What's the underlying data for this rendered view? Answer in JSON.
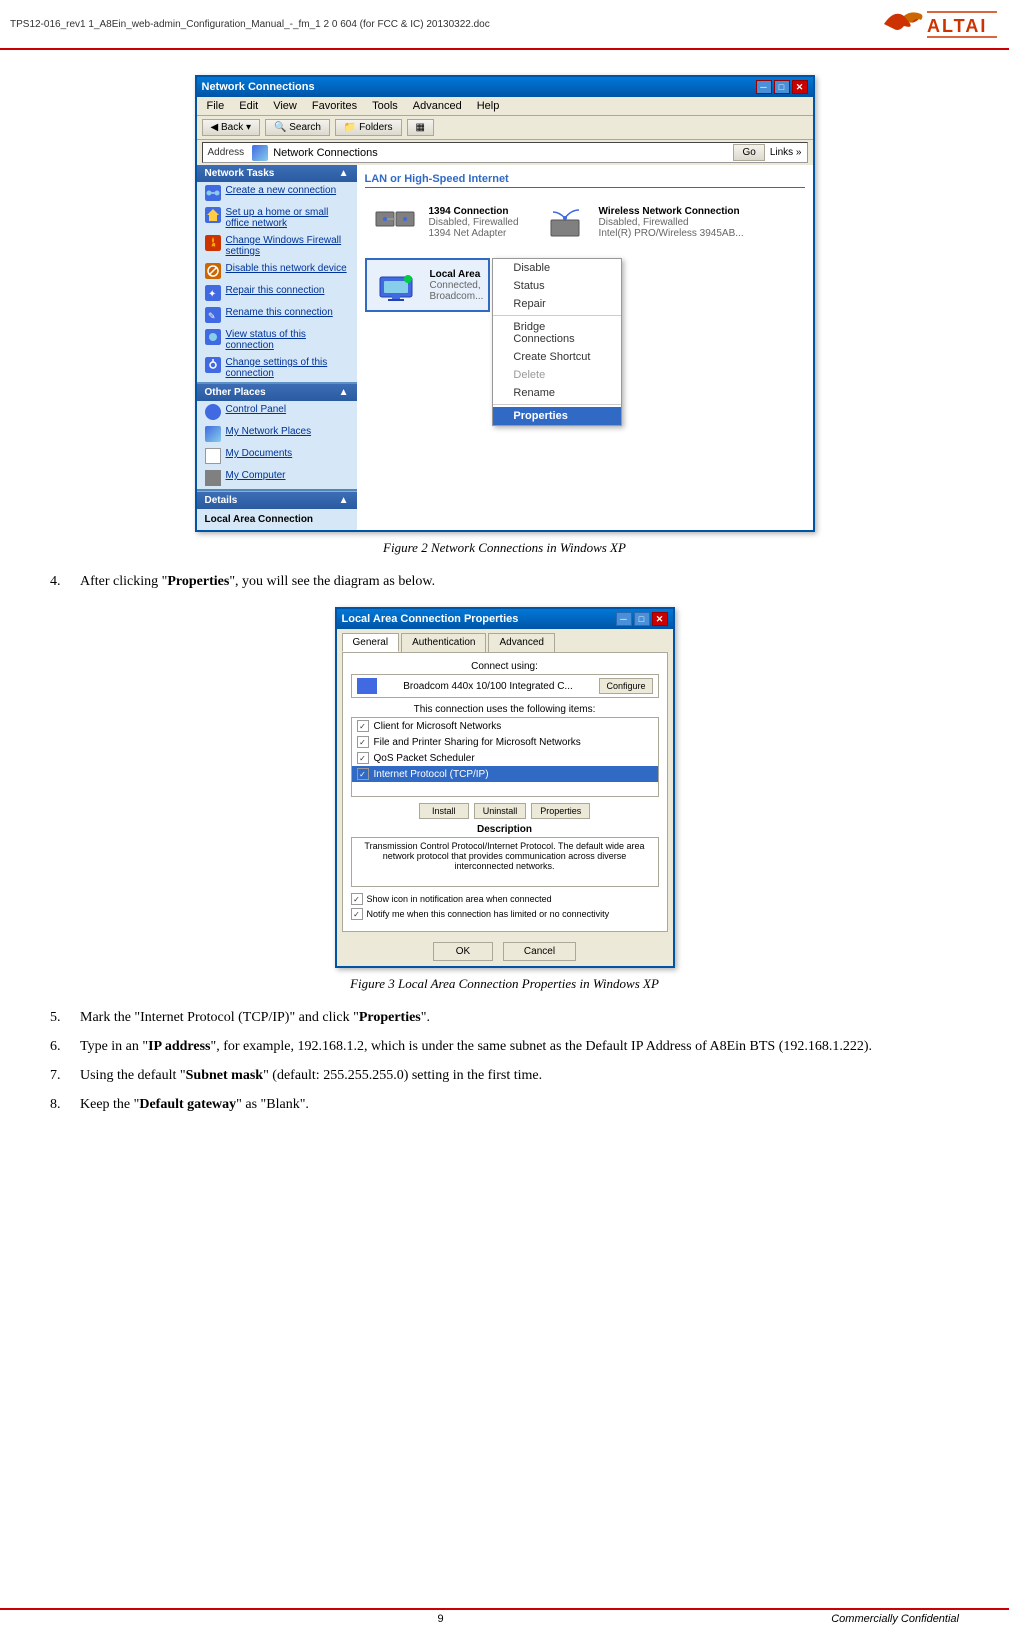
{
  "header": {
    "title": "TPS12-016_rev1 1_A8Ein_web-admin_Configuration_Manual_-_fm_1 2 0 604 (for FCC & IC) 20130322.doc",
    "logo_text": "ALTAI"
  },
  "figure2": {
    "caption": "Figure 2    Network Connections in Windows XP",
    "window_title": "Network Connections",
    "menubar": [
      "File",
      "Edit",
      "View",
      "Favorites",
      "Tools",
      "Advanced",
      "Help"
    ],
    "toolbar_buttons": [
      "Back",
      "Search",
      "Folders"
    ],
    "address_label": "Address",
    "address_value": "Network Connections",
    "sidebar": {
      "network_tasks_title": "Network Tasks",
      "network_tasks_items": [
        "Create a new connection",
        "Set up a home or small office network",
        "Change Windows Firewall settings",
        "Disable this network device",
        "Repair this connection",
        "Rename this connection",
        "View status of this connection",
        "Change settings of this connection"
      ],
      "other_places_title": "Other Places",
      "other_places_items": [
        "Control Panel",
        "My Network Places",
        "My Documents",
        "My Computer"
      ],
      "details_title": "Details",
      "details_content": "Local Area Connection"
    },
    "section_title": "LAN or High-Speed Internet",
    "connections": [
      {
        "name": "1394 Connection",
        "status": "Disabled, Firewalled",
        "adapter": "1394 Net Adapter"
      },
      {
        "name": "Wireless Network Connection",
        "status": "Disabled, Firewalled",
        "adapter": "Intel(R) PRO/Wireless 3945AB..."
      }
    ],
    "local_area": {
      "name": "Local Area Connected,",
      "status": "Broadcom..."
    },
    "context_menu": {
      "items": [
        {
          "label": "Disable",
          "disabled": false,
          "selected": false
        },
        {
          "label": "Status",
          "disabled": false,
          "selected": false
        },
        {
          "label": "Repair",
          "disabled": false,
          "selected": false
        },
        {
          "label": "separator"
        },
        {
          "label": "Bridge Connections",
          "disabled": false,
          "selected": false
        },
        {
          "label": "Create Shortcut",
          "disabled": false,
          "selected": false
        },
        {
          "label": "Delete",
          "disabled": true,
          "selected": false
        },
        {
          "label": "Rename",
          "disabled": false,
          "selected": false
        },
        {
          "label": "separator2"
        },
        {
          "label": "Properties",
          "disabled": false,
          "selected": true
        }
      ]
    }
  },
  "para4": {
    "text": "After clicking “Properties”, you will see the diagram as below."
  },
  "figure3": {
    "caption": "Figure 3    Local Area Connection Properties in Windows XP",
    "window_title": "Local Area Connection Properties",
    "tabs": [
      "General",
      "Authentication",
      "Advanced"
    ],
    "active_tab": "General",
    "connect_using_label": "Connect using:",
    "adapter_name": "Broadcom 440x 10/100 Integrated C...",
    "configure_btn": "Configure",
    "components_label": "This connection uses the following items:",
    "components": [
      {
        "checked": true,
        "name": "Client for Microsoft Networks",
        "selected": false
      },
      {
        "checked": true,
        "name": "File and Printer Sharing for Microsoft Networks",
        "selected": false
      },
      {
        "checked": true,
        "name": "QoS Packet Scheduler",
        "selected": false
      },
      {
        "checked": true,
        "name": "Internet Protocol (TCP/IP)",
        "selected": true
      }
    ],
    "action_buttons": [
      "Install",
      "Uninstall",
      "Properties"
    ],
    "description_label": "Description",
    "description_text": "Transmission Control Protocol/Internet Protocol. The default wide area network protocol that provides communication across diverse interconnected networks.",
    "checkbox1": "Show icon in notification area when connected",
    "checkbox2": "Notify me when this connection has limited or no connectivity",
    "ok_btn": "OK",
    "cancel_btn": "Cancel"
  },
  "items": [
    {
      "num": "5.",
      "text": "Mark the “Internet Protocol (TCP/IP)” and click “",
      "bold": "Properties",
      "text2": "”."
    },
    {
      "num": "6.",
      "text": "Type in an “",
      "bold1": "IP address",
      "text2": "”, for example, 192.168.1.2, which is under the same subnet as the Default IP Address of A8Ein BTS (192.168.1.222)."
    },
    {
      "num": "7.",
      "text": "Using the default “",
      "bold": "Subnet mask",
      "text2": "” (default: 255.255.255.0) setting in the first time."
    },
    {
      "num": "8.",
      "text": "Keep the “",
      "bold": "Default gateway",
      "text2": "” as “Blank”."
    }
  ],
  "footer": {
    "page": "9",
    "confidential": "Commercially Confidential"
  }
}
